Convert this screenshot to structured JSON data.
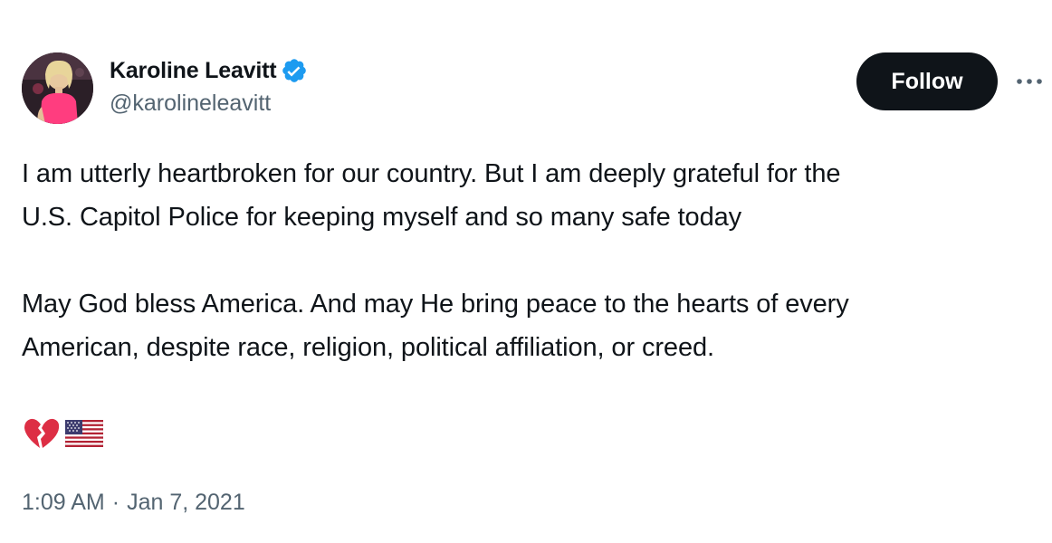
{
  "author": {
    "display_name": "Karoline Leavitt",
    "handle": "@karolineleavitt",
    "verified_icon": "verified-badge-icon",
    "verified_color": "#1d9bf0"
  },
  "actions": {
    "follow_label": "Follow",
    "more_icon": "more-horizontal-icon"
  },
  "tweet": {
    "line_1": "I am utterly heartbroken for our country. But I am deeply grateful for the",
    "line_2": "U.S. Capitol Police for keeping myself and so many safe today",
    "line_3": "May God bless America. And may He bring peace to the hearts of every",
    "line_4": "American, despite race, religion, political affiliation, or creed.",
    "emojis": [
      "broken-heart-icon",
      "us-flag-icon"
    ]
  },
  "meta": {
    "time": "1:09 AM",
    "separator": "·",
    "date": "Jan 7, 2021"
  },
  "colors": {
    "text": "#0f1419",
    "secondary": "#536471",
    "follow_bg": "#0f1419",
    "follow_text": "#ffffff"
  }
}
